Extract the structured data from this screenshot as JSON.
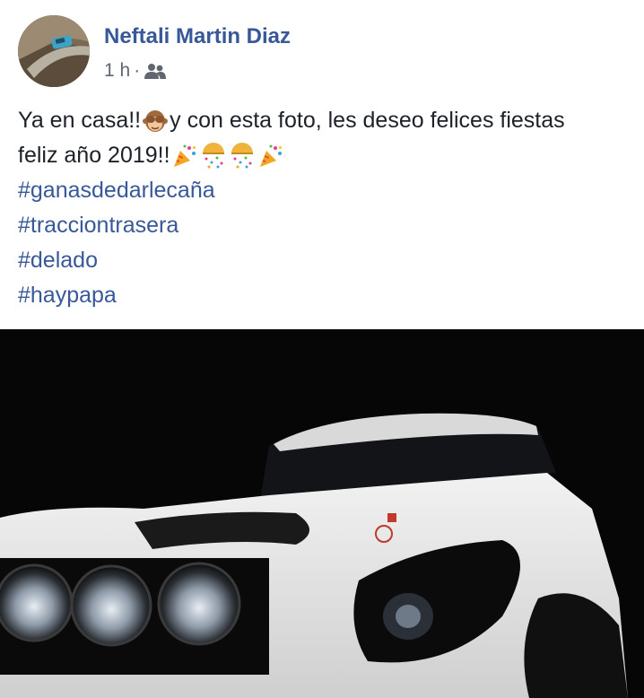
{
  "post": {
    "author": "Neftali Martin Diaz",
    "time": "1 h",
    "separator": "·",
    "audience_icon": "friends-icon",
    "text_line1_a": "Ya en casa!!",
    "text_line1_b": " y con esta foto, les deseo felices fiestas",
    "text_line2": "feliz año 2019!!",
    "emojis": [
      "see-no-evil-monkey",
      "party-popper",
      "confetti-ball",
      "confetti-ball",
      "party-popper"
    ],
    "hashtags": [
      "#ganasdedarlecaña",
      "#tracciontrasera",
      "#delado",
      "#haypapa"
    ]
  },
  "colors": {
    "link": "#385898",
    "text": "#1d2129",
    "meta": "#606770"
  }
}
